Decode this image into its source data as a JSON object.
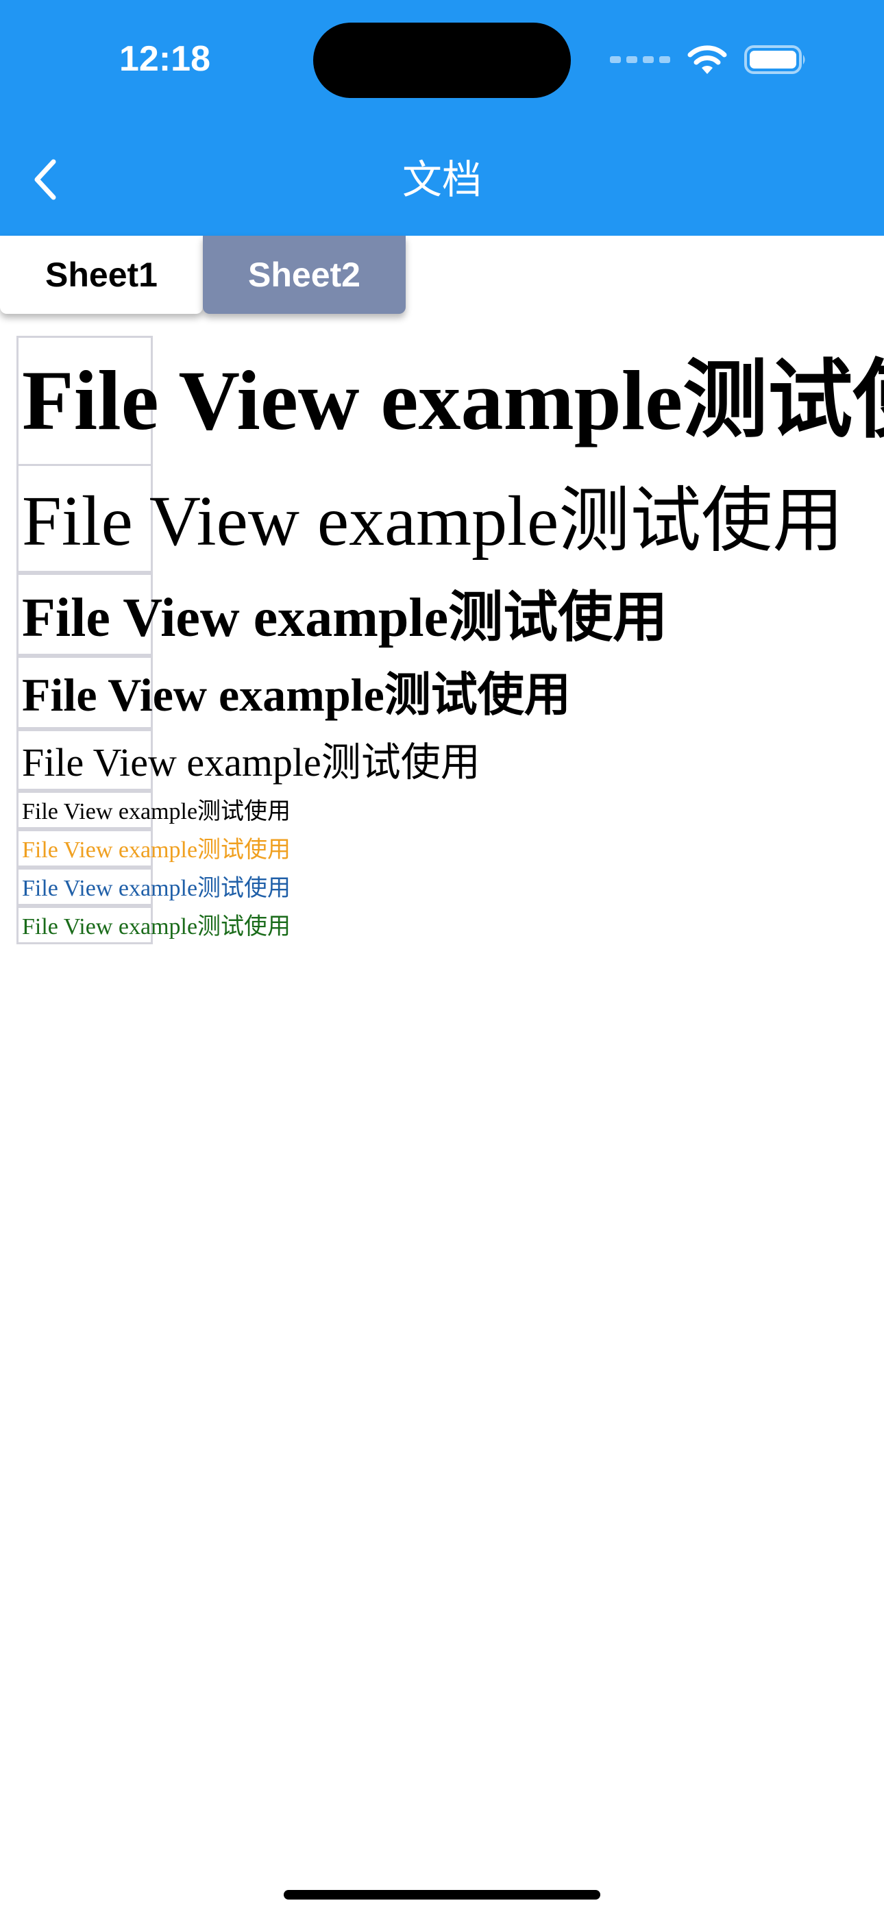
{
  "status_bar": {
    "time": "12:18"
  },
  "nav": {
    "title": "文档",
    "back_icon": "chevron-left-icon"
  },
  "sheet_tabs": [
    {
      "label": "Sheet1",
      "active": true
    },
    {
      "label": "Sheet2",
      "active": false
    }
  ],
  "document": {
    "rows": [
      {
        "text": "File View example测试使用",
        "color": "#000000"
      },
      {
        "text": "File View example测试使用",
        "color": "#000000"
      },
      {
        "text": "File View example测试使用",
        "color": "#000000"
      },
      {
        "text": "File View example测试使用",
        "color": "#000000"
      },
      {
        "text": "File View example测试使用",
        "color": "#000000"
      },
      {
        "text": "File View example测试使用",
        "color": "#000000"
      },
      {
        "text": "File View example测试使用",
        "color": "#f0a020"
      },
      {
        "text": "File View example测试使用",
        "color": "#1f5fa8"
      },
      {
        "text": "File View example测试使用",
        "color": "#1a6b1a"
      }
    ]
  },
  "colors": {
    "header_bg": "#2196f3",
    "tab_inactive_bg": "#7b8aad",
    "cell_border": "#d4d4dc"
  }
}
